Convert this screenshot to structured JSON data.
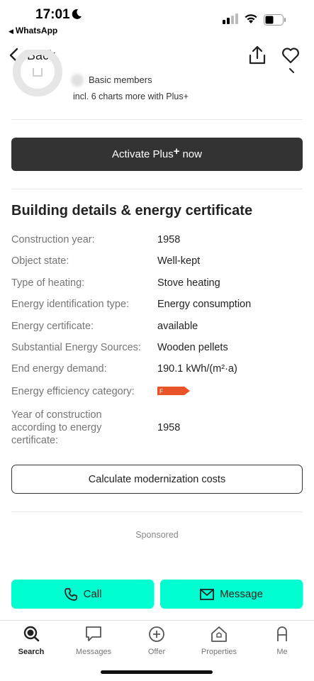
{
  "status": {
    "time": "17:01",
    "back_app": "WhatsApp"
  },
  "nav": {
    "back_label": "Back"
  },
  "plus_section": {
    "basic_members": "Basic members",
    "charts_note": "incl. 6 charts more with Plus+",
    "activate_prefix": "Activate Plus",
    "activate_plus_sign": "+",
    "activate_suffix": "now"
  },
  "building": {
    "title": "Building details & energy certificate",
    "details": [
      {
        "label": "Construction year:",
        "value": "1958"
      },
      {
        "label": "Object state:",
        "value": "Well-kept"
      },
      {
        "label": "Type of heating:",
        "value": "Stove heating"
      },
      {
        "label": "Energy identification type:",
        "value": "Energy consumption"
      },
      {
        "label": "Energy certificate:",
        "value": "available"
      },
      {
        "label": "Substantial Energy Sources:",
        "value": "Wooden pellets"
      },
      {
        "label": "End energy demand:",
        "value": "190.1 kWh/(m²·a)"
      },
      {
        "label": "Energy efficiency category:",
        "value": "F"
      },
      {
        "label": "Year of construction according to energy certificate:",
        "value": "1958"
      }
    ],
    "energy_badge_color": "#e8532a",
    "calc_button": "Calculate modernization costs"
  },
  "sponsored": "Sponsored",
  "cta": {
    "call": "Call",
    "message": "Message",
    "color": "#00ffd0"
  },
  "tabs": [
    {
      "label": "Search",
      "icon": "search-icon",
      "active": true
    },
    {
      "label": "Messages",
      "icon": "chat-icon",
      "active": false
    },
    {
      "label": "Offer",
      "icon": "plus-circle-icon",
      "active": false
    },
    {
      "label": "Properties",
      "icon": "house-icon",
      "active": false
    },
    {
      "label": "Me",
      "icon": "person-icon",
      "active": false
    }
  ]
}
